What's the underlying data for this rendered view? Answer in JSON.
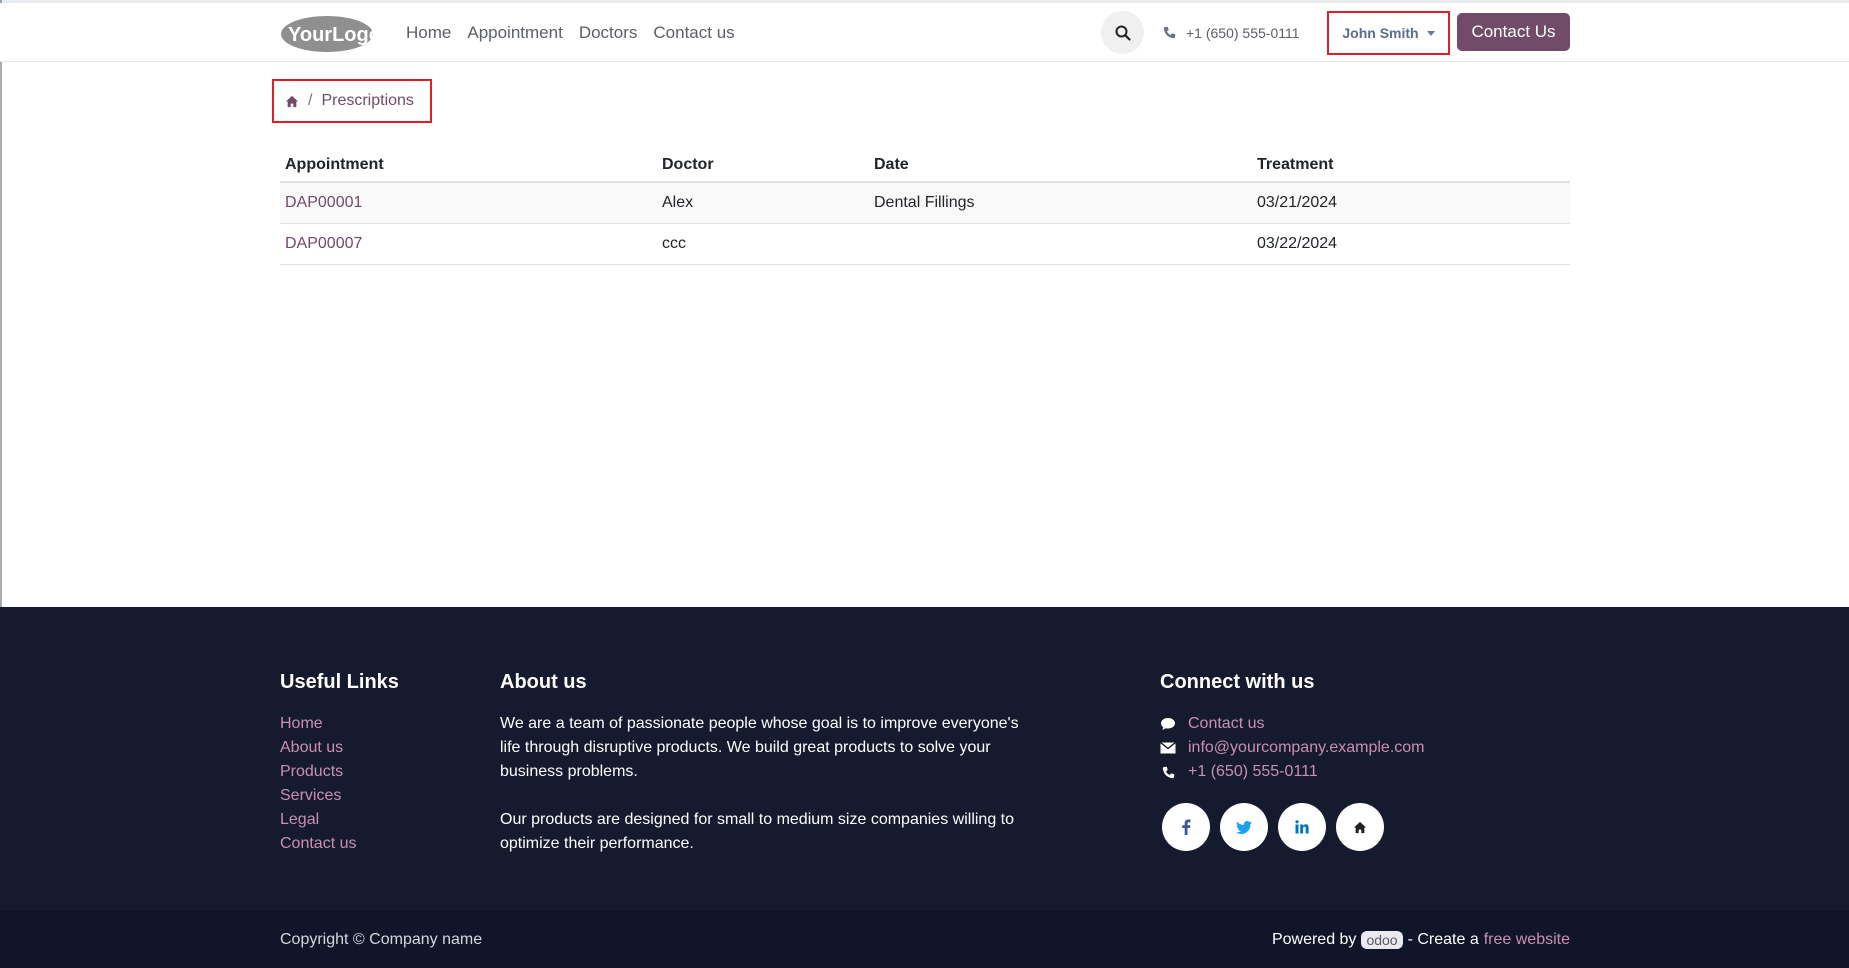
{
  "colors": {
    "brand": "#714b67",
    "footer_bg": "#161a2e",
    "footer_link": "#c790b3",
    "highlight_border": "#e01d2a"
  },
  "header": {
    "logo_text": "YourLogo",
    "nav": [
      "Home",
      "Appointment",
      "Doctors",
      "Contact us"
    ],
    "phone": "+1 (650) 555-0111",
    "user_name": "John Smith",
    "contact_button": "Contact Us",
    "search_icon": "search-icon"
  },
  "breadcrumb": {
    "home_icon": "home-icon",
    "separator": "/",
    "current": "Prescriptions"
  },
  "table": {
    "headers": [
      "Appointment",
      "Doctor",
      "Date",
      "Treatment"
    ],
    "rows": [
      [
        "DAP00001",
        "Alex",
        "Dental Fillings",
        "03/21/2024"
      ],
      [
        "DAP00007",
        "ccc",
        "",
        "03/22/2024"
      ]
    ]
  },
  "footer": {
    "useful_links": {
      "title": "Useful Links",
      "links": [
        "Home",
        "About us",
        "Products",
        "Services",
        "Legal",
        "Contact us"
      ]
    },
    "about": {
      "title": "About us",
      "p1": "We are a team of passionate people whose goal is to improve everyone's life through disruptive products. We build great products to solve your business problems.",
      "p2": "Our products are designed for small to medium size companies willing to optimize their performance."
    },
    "connect": {
      "title": "Connect with us",
      "contact": "Contact us",
      "email": "info@yourcompany.example.com",
      "phone": "+1 (650) 555-0111",
      "socials": [
        "facebook-icon",
        "twitter-icon",
        "linkedin-icon",
        "home-icon"
      ]
    }
  },
  "copyright": {
    "text": "Copyright © Company name",
    "powered_by": "Powered by",
    "odoo": "odoo",
    "create": "- Create a",
    "free_website": "free website"
  }
}
